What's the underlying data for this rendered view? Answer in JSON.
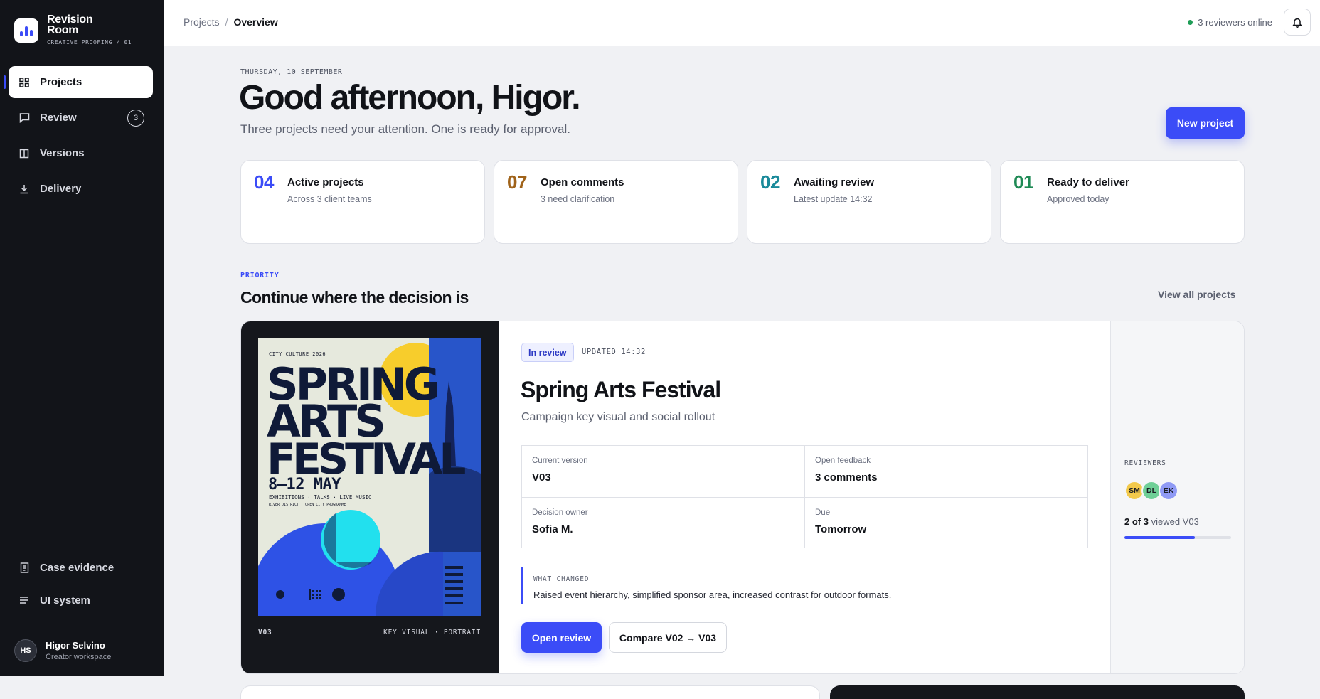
{
  "brand": {
    "name_line1": "Revision",
    "name_line2": "Room",
    "subtitle": "CREATIVE PROOFING / 01"
  },
  "nav": {
    "items": [
      {
        "label": "Projects",
        "icon": "grid-icon",
        "active": true
      },
      {
        "label": "Review",
        "icon": "comment-icon",
        "badge": "3"
      },
      {
        "label": "Versions",
        "icon": "columns-icon"
      },
      {
        "label": "Delivery",
        "icon": "download-icon"
      }
    ],
    "bottom": [
      {
        "label": "Case evidence",
        "icon": "document-icon"
      },
      {
        "label": "UI system",
        "icon": "lines-icon"
      }
    ]
  },
  "user": {
    "initials": "HS",
    "name": "Higor Selvino",
    "role": "Creator workspace"
  },
  "topbar": {
    "breadcrumb": [
      "Projects",
      "Overview"
    ],
    "separator": "/",
    "online": "3 reviewers online"
  },
  "hero": {
    "date": "THURSDAY, 10 SEPTEMBER",
    "greeting": "Good afternoon, Higor.",
    "subtitle": "Three projects need your attention. One is ready for approval.",
    "new_button": "New project"
  },
  "stats": [
    {
      "number": "04",
      "title": "Active projects",
      "sub": "Across 3 client teams",
      "color": "#3b4cf7"
    },
    {
      "number": "07",
      "title": "Open comments",
      "sub": "3 need clarification",
      "color": "#a0631a"
    },
    {
      "number": "02",
      "title": "Awaiting review",
      "sub": "Latest update 14:32",
      "color": "#1a8a9a"
    },
    {
      "number": "01",
      "title": "Ready to deliver",
      "sub": "Approved today",
      "color": "#1f8a55"
    }
  ],
  "section": {
    "eyebrow": "PRIORITY",
    "title": "Continue where the decision is",
    "view_all": "View all projects"
  },
  "project": {
    "status": "In review",
    "updated": "UPDATED 14:32",
    "title": "Spring Arts Festival",
    "subtitle": "Campaign key visual and social rollout",
    "facts": [
      {
        "label": "Current version",
        "value": "V03"
      },
      {
        "label": "Open feedback",
        "value": "3 comments"
      },
      {
        "label": "Decision owner",
        "value": "Sofia M."
      },
      {
        "label": "Due",
        "value": "Tomorrow"
      }
    ],
    "changed_label": "WHAT CHANGED",
    "changed_text": "Raised event hierarchy, simplified sponsor area, increased contrast for outdoor formats.",
    "open_button": "Open review",
    "compare_button": "Compare V02 → V03",
    "poster": {
      "kicker": "CITY CULTURE 2026",
      "line1": "SPRING",
      "line2": "ARTS",
      "line3": "FESTIVAL",
      "dates": "8—12 MAY",
      "program": "EXHIBITIONS · TALKS · LIVE MUSIC",
      "small": "RIVER DISTRICT · OPEN CITY PROGRAMME",
      "version": "V03",
      "format": "KEY VISUAL · PORTRAIT"
    },
    "reviewers": {
      "label": "REVIEWERS",
      "people": [
        {
          "initials": "SM",
          "color": "#f2c94c"
        },
        {
          "initials": "DL",
          "color": "#6fcf97"
        },
        {
          "initials": "EK",
          "color": "#8f9af5"
        }
      ],
      "viewed_count": "2 of 3",
      "viewed_suffix": "viewed V03",
      "progress": 0.66
    }
  }
}
